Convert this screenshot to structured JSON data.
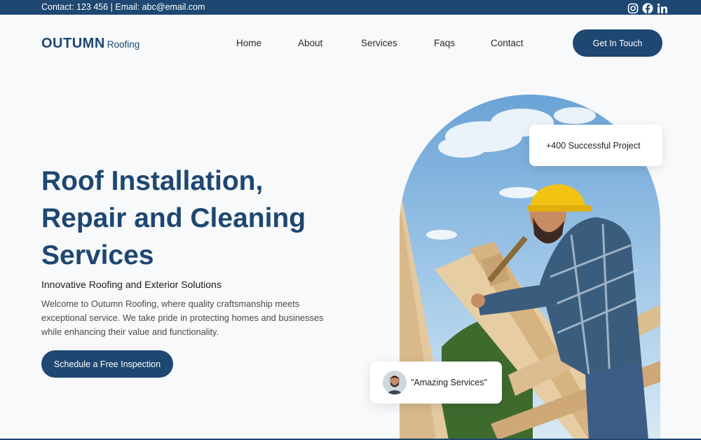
{
  "topbar": {
    "contact": "Contact: 123 456 |  Email: abc@email.com",
    "social": [
      "instagram-icon",
      "facebook-icon",
      "linkedin-icon"
    ]
  },
  "header": {
    "brand_main": "OUTUMN",
    "brand_sub": "Roofing",
    "nav": [
      "Home",
      "About",
      "Services",
      "Faqs",
      "Contact"
    ],
    "cta": "Get In Touch"
  },
  "hero": {
    "headline_1": "Roof Installation,",
    "headline_2": "Repair and Cleaning",
    "headline_3": "Services",
    "subhead": "Innovative Roofing and Exterior Solutions",
    "intro": "Welcome to Outumn Roofing, where quality craftsmanship meets exceptional service. We take pride in protecting homes and businesses while enhancing their value and functionality.",
    "button": "Schedule a Free Inspection",
    "project_badge": "+400 Successful Project",
    "review_badge": "\"Amazing Services\""
  },
  "colors": {
    "primary": "#1e4771",
    "background": "#f7f9fa"
  }
}
